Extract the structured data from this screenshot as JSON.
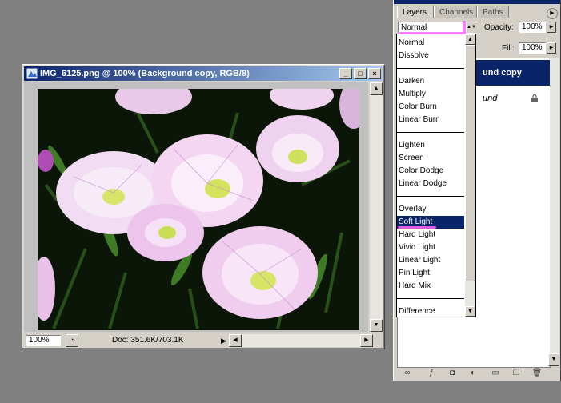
{
  "document": {
    "title": "IMG_6125.png @ 100% (Background copy, RGB/8)",
    "zoom": "100%",
    "doc_info": "Doc: 351.6K/703.1K"
  },
  "palette": {
    "tabs": [
      "Layers",
      "Channels",
      "Paths"
    ],
    "active_tab": "Layers",
    "blend_mode": "Normal",
    "opacity_label": "Opacity:",
    "opacity_value": "100%",
    "fill_label": "Fill:",
    "fill_value": "100%",
    "layers": [
      {
        "name": "und copy",
        "selected": true
      },
      {
        "name": "und",
        "selected": false,
        "locked": true
      }
    ]
  },
  "blend_dropdown": {
    "groups": [
      [
        "Normal",
        "Dissolve"
      ],
      [
        "Darken",
        "Multiply",
        "Color Burn",
        "Linear Burn"
      ],
      [
        "Lighten",
        "Screen",
        "Color Dodge",
        "Linear Dodge"
      ],
      [
        "Overlay",
        "Soft Light",
        "Hard Light",
        "Vivid Light",
        "Linear Light",
        "Pin Light",
        "Hard Mix"
      ],
      [
        "Difference"
      ]
    ],
    "highlighted": "Soft Light"
  },
  "colors": {
    "title_active": "#0a246a",
    "selection": "#0a246a",
    "annotation_pink": "#ff66ff",
    "face": "#d4d0c8",
    "desktop": "#808080"
  }
}
